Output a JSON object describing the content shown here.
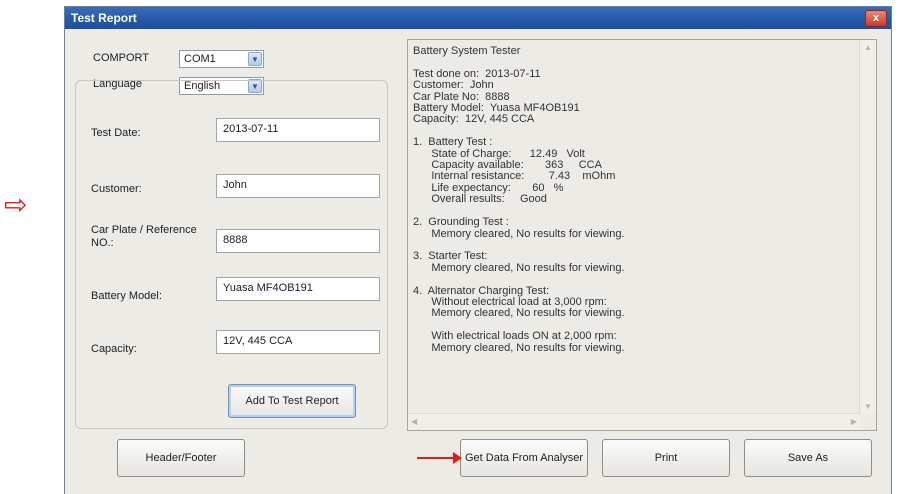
{
  "window": {
    "title": "Test Report",
    "close_label": "x"
  },
  "settings": {
    "comport_label": "COMPORT",
    "comport_value": "COM1",
    "language_label": "Language",
    "language_value": "English"
  },
  "form": {
    "test_date_label": "Test Date:",
    "test_date_value": "2013-07-11",
    "customer_label": "Customer:",
    "customer_value": "John",
    "car_plate_label_line1": "Car Plate / Reference",
    "car_plate_label_line2": "NO.:",
    "car_plate_value": "8888",
    "battery_model_label": "Battery Model:",
    "battery_model_value": "Yuasa MF4OB191",
    "capacity_label": "Capacity:",
    "capacity_value": "12V, 445 CCA",
    "add_button": "Add To Test Report"
  },
  "report": {
    "text": "Battery System Tester\n\nTest done on:  2013-07-11\nCustomer:  John\nCar Plate No:  8888\nBattery Model:  Yuasa MF4OB191\nCapacity:  12V, 445 CCA\n\n1.  Battery Test :\n      State of Charge:      12.49   Volt\n      Capacity available:       363     CCA\n      Internal resistance:        7.43    mOhm\n      Life expectancy:       60   %\n      Overall results:     Good\n\n2.  Grounding Test :\n      Memory cleared, No results for viewing.\n\n3.  Starter Test:\n      Memory cleared, No results for viewing.\n\n4.  Alternator Charging Test:\n      Without electrical load at 3,000 rpm:\n      Memory cleared, No results for viewing.\n\n      With electrical loads ON at 2,000 rpm:\n      Memory cleared, No results for viewing."
  },
  "buttons": {
    "header_footer": "Header/Footer",
    "get_data": "Get Data From Analyser",
    "print": "Print",
    "save_as": "Save As"
  },
  "annotations": {
    "hollow_arrow": "⇨"
  }
}
